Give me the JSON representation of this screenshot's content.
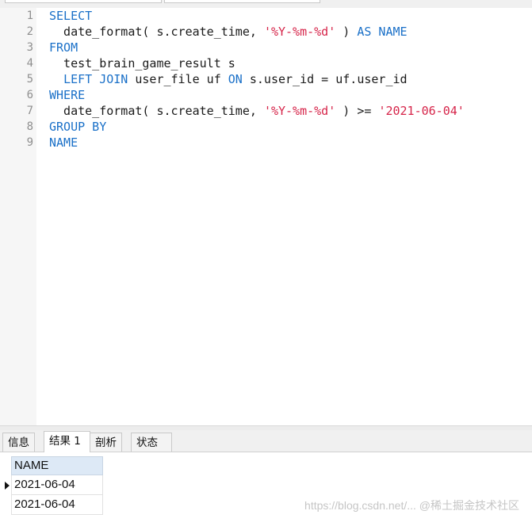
{
  "editor": {
    "lines": [
      {
        "no": "1",
        "tokens": [
          {
            "t": "SELECT",
            "c": "kw"
          }
        ]
      },
      {
        "no": "2",
        "tokens": [
          {
            "t": "  date_format( s.create_time, ",
            "c": ""
          },
          {
            "t": "'%Y-%m-%d'",
            "c": "str"
          },
          {
            "t": " ) ",
            "c": ""
          },
          {
            "t": "AS NAME",
            "c": "kw"
          }
        ]
      },
      {
        "no": "3",
        "tokens": [
          {
            "t": "FROM",
            "c": "kw"
          }
        ]
      },
      {
        "no": "4",
        "tokens": [
          {
            "t": "  test_brain_game_result s",
            "c": ""
          }
        ]
      },
      {
        "no": "5",
        "tokens": [
          {
            "t": "  ",
            "c": ""
          },
          {
            "t": "LEFT JOIN",
            "c": "kw"
          },
          {
            "t": " user_file uf ",
            "c": ""
          },
          {
            "t": "ON",
            "c": "kw"
          },
          {
            "t": " s.user_id = uf.user_id",
            "c": ""
          }
        ]
      },
      {
        "no": "6",
        "tokens": [
          {
            "t": "WHERE",
            "c": "kw"
          }
        ]
      },
      {
        "no": "7",
        "tokens": [
          {
            "t": "  date_format( s.create_time, ",
            "c": ""
          },
          {
            "t": "'%Y-%m-%d'",
            "c": "str"
          },
          {
            "t": " ) >= ",
            "c": ""
          },
          {
            "t": "'2021-06-04'",
            "c": "str"
          }
        ]
      },
      {
        "no": "8",
        "tokens": [
          {
            "t": "GROUP BY",
            "c": "kw"
          }
        ]
      },
      {
        "no": "9",
        "tokens": [
          {
            "t": "NAME",
            "c": "kw"
          }
        ]
      }
    ]
  },
  "tabs": [
    {
      "label": "信息",
      "active": false
    },
    {
      "label": "结果 1",
      "active": true
    },
    {
      "label": "剖析",
      "active": false
    },
    {
      "label": "状态",
      "active": false
    }
  ],
  "results": {
    "columns": [
      "NAME"
    ],
    "rows": [
      [
        "2021-06-04"
      ],
      [
        "2021-06-04"
      ]
    ]
  },
  "watermark": "https://blog.csdn.net/...  @稀土掘金技术社区"
}
